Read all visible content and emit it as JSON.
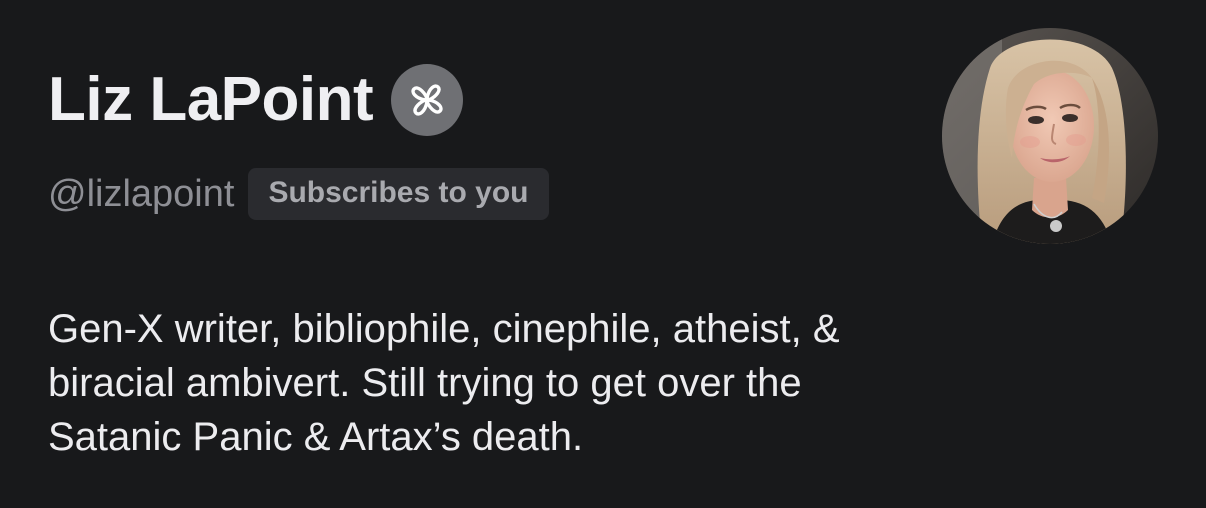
{
  "profile": {
    "display_name": "Liz LaPoint",
    "badge_icon": "founding-member-badge-icon",
    "handle": "@lizlapoint",
    "subscribes_label": "Subscribes to you",
    "bio": "Gen-X writer, bibliophile, cinephile, atheist, &\nbiracial ambivert. Still trying to get over the\nSatanic Panic & Artax’s death.",
    "avatar_icon": "profile-photo"
  },
  "colors": {
    "background": "#18191b",
    "name_text": "#efeff2",
    "handle_text": "#8e8f95",
    "chip_background": "#2a2b2f",
    "chip_text": "#a9aaaf",
    "badge_background": "#6f7074"
  }
}
